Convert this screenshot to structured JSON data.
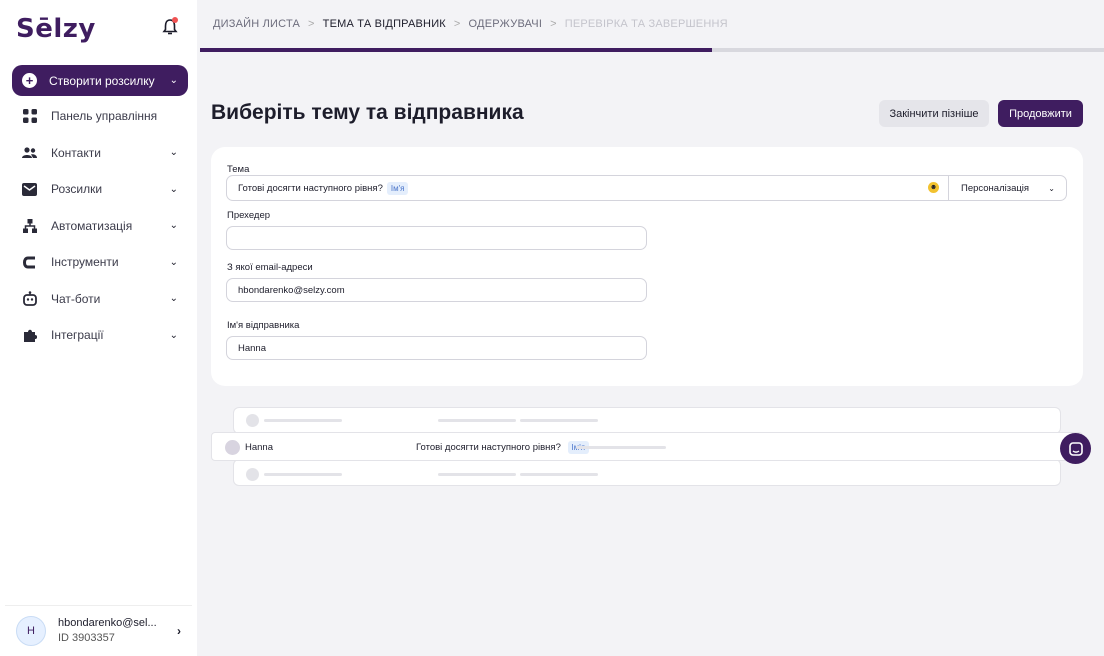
{
  "brand": {
    "logo": "Sēlzy",
    "accent": "#3f1d60"
  },
  "sidebar": {
    "create_label": "Створити розсилку",
    "items": [
      {
        "label": "Панель управління",
        "icon": "dashboard-icon",
        "has_chevron": false
      },
      {
        "label": "Контакти",
        "icon": "contacts-icon",
        "has_chevron": true
      },
      {
        "label": "Розсилки",
        "icon": "mail-icon",
        "has_chevron": true
      },
      {
        "label": "Автоматизація",
        "icon": "automation-icon",
        "has_chevron": true
      },
      {
        "label": "Інструменти",
        "icon": "tools-icon",
        "has_chevron": true
      },
      {
        "label": "Чат-боти",
        "icon": "bot-icon",
        "has_chevron": true
      },
      {
        "label": "Інтеграції",
        "icon": "puzzle-icon",
        "has_chevron": true
      }
    ],
    "user": {
      "initial": "H",
      "email": "hbondarenko@sel...",
      "id": "ID 3903357"
    }
  },
  "breadcrumb": {
    "steps": [
      {
        "label": "ДИЗАЙН ЛИСТА",
        "state": "done"
      },
      {
        "label": "ТЕМА ТА ВІДПРАВНИК",
        "state": "active"
      },
      {
        "label": "ОДЕРЖУВАЧІ",
        "state": "next"
      },
      {
        "label": "ПЕРЕВІРКА ТА ЗАВЕРШЕННЯ",
        "state": "future"
      }
    ],
    "separator": ">",
    "progress_fraction": 0.566
  },
  "header": {
    "title": "Виберіть тему та відправника",
    "later_label": "Закінчити пізніше",
    "next_label": "Продовжити"
  },
  "form": {
    "subject_label": "Тема",
    "subject_value": "Готові досягти наступного рівня?",
    "subject_tag": "Ім'я",
    "personalization_label": "Персоналізація",
    "preheader_label": "Прехедер",
    "preheader_value": "",
    "from_email_label": "З якої email-адреси",
    "from_email_value": "hbondarenko@selzy.com",
    "sender_name_label": "Ім'я відправника",
    "sender_name_value": "Hanna"
  },
  "preview": {
    "sender": "Hanna",
    "subject": "Готові досягти наступного рівня?",
    "tag": "Ім'я"
  }
}
